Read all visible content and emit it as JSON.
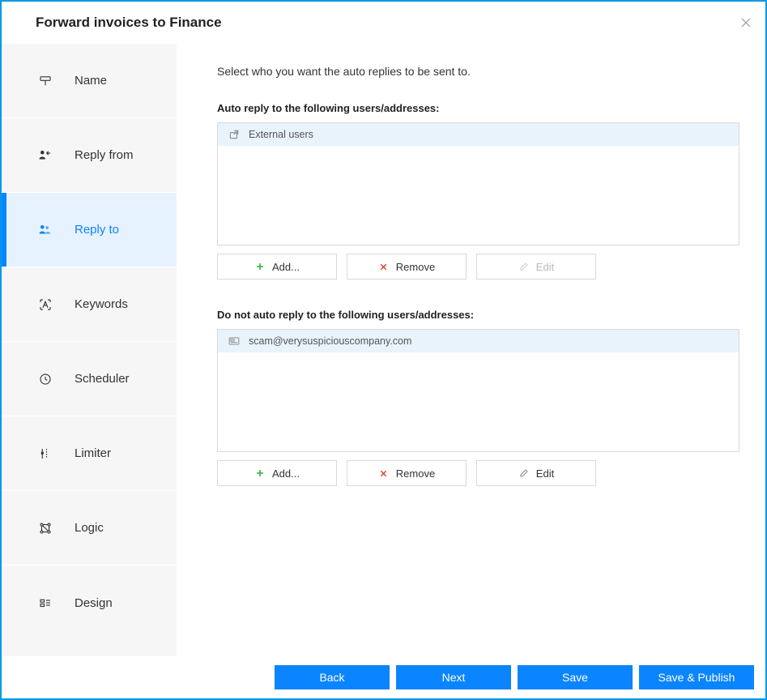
{
  "window": {
    "title": "Forward invoices to Finance"
  },
  "sidebar": {
    "items": [
      {
        "id": "name",
        "label": "Name"
      },
      {
        "id": "replyfrom",
        "label": "Reply from"
      },
      {
        "id": "replyto",
        "label": "Reply to"
      },
      {
        "id": "keywords",
        "label": "Keywords"
      },
      {
        "id": "scheduler",
        "label": "Scheduler"
      },
      {
        "id": "limiter",
        "label": "Limiter"
      },
      {
        "id": "logic",
        "label": "Logic"
      },
      {
        "id": "design",
        "label": "Design"
      }
    ],
    "active_id": "replyto"
  },
  "main": {
    "intro": "Select who you want the auto replies to be sent to.",
    "include_label": "Auto reply to the following users/addresses:",
    "exclude_label": "Do not auto reply to the following users/addresses:",
    "include_items": [
      {
        "icon": "external",
        "text": "External users",
        "selected": true
      }
    ],
    "exclude_items": [
      {
        "icon": "email",
        "text": "scam@verysuspiciouscompany.com",
        "selected": true
      }
    ],
    "buttons": {
      "add": "Add...",
      "remove": "Remove",
      "edit": "Edit"
    }
  },
  "footer": {
    "back": "Back",
    "next": "Next",
    "save": "Save",
    "save_publish": "Save & Publish"
  }
}
